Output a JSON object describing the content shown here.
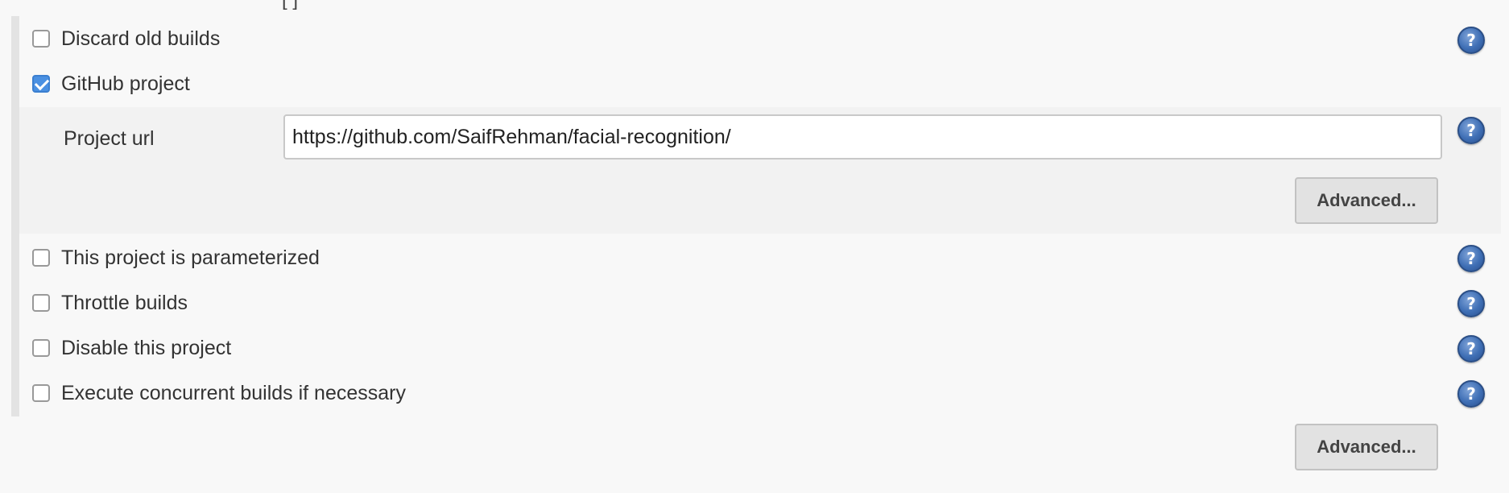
{
  "top_fragment": {
    "bracket_text": "[ ]",
    "link_text": "      "
  },
  "options": {
    "discard_old_builds": {
      "label": "Discard old builds",
      "checked": false
    },
    "github_project": {
      "label": "GitHub project",
      "checked": true
    },
    "parameterized": {
      "label": "This project is parameterized",
      "checked": false
    },
    "throttle_builds": {
      "label": "Throttle builds",
      "checked": false
    },
    "disable_project": {
      "label": "Disable this project",
      "checked": false
    },
    "concurrent_builds": {
      "label": "Execute concurrent builds if necessary",
      "checked": false
    }
  },
  "github_section": {
    "field_label": "Project url",
    "field_value": "https://github.com/SaifRehman/facial-recognition/",
    "advanced_label": "Advanced..."
  },
  "footer": {
    "advanced_label": "Advanced..."
  },
  "help": {
    "glyph": "?"
  },
  "colors": {
    "checkbox_checked": "#4a90e2",
    "help_icon": "#3f6fb5",
    "panel_background": "#f2f2f2",
    "page_background": "#f8f8f8"
  }
}
